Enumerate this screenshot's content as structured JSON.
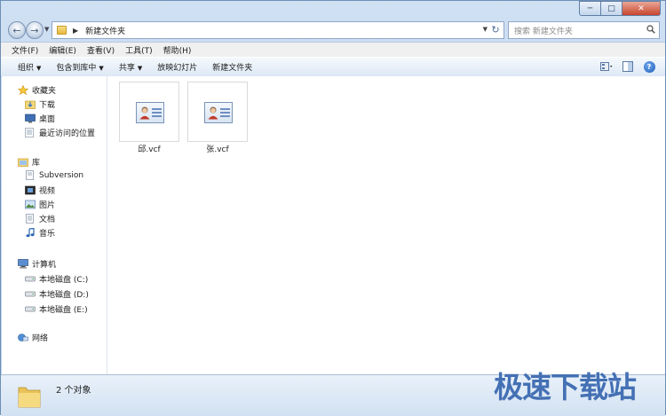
{
  "address": {
    "path": "新建文件夹"
  },
  "search": {
    "placeholder": "搜索 新建文件夹"
  },
  "menu": {
    "items": [
      "文件(F)",
      "编辑(E)",
      "查看(V)",
      "工具(T)",
      "帮助(H)"
    ]
  },
  "commands": {
    "organize": "组织",
    "include_in_library": "包含到库中",
    "share": "共享",
    "slideshow": "放映幻灯片",
    "new_folder": "新建文件夹"
  },
  "sidebar": {
    "favorites": {
      "header": "收藏夹",
      "items": [
        "下载",
        "桌面",
        "最近访问的位置"
      ]
    },
    "libraries": {
      "header": "库",
      "items": [
        "Subversion",
        "视频",
        "图片",
        "文档",
        "音乐"
      ]
    },
    "computer": {
      "header": "计算机",
      "items": [
        "本地磁盘 (C:)",
        "本地磁盘 (D:)",
        "本地磁盘 (E:)"
      ]
    },
    "network": {
      "header": "网络"
    }
  },
  "files": [
    {
      "name": "邱.vcf",
      "icon": "vcard-icon"
    },
    {
      "name": "张.vcf",
      "icon": "vcard-icon"
    }
  ],
  "status": {
    "count_text": "2 个对象"
  },
  "watermark": {
    "text": "极速下载站"
  },
  "colors": {
    "chrome": "#cfe0f3",
    "close_button": "#c7452d",
    "watermark": "#4470b4"
  }
}
